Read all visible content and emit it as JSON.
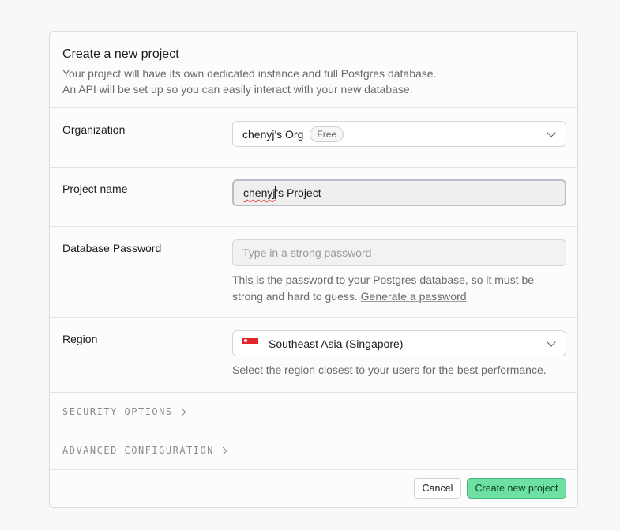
{
  "header": {
    "title": "Create a new project",
    "description_line1": "Your project will have its own dedicated instance and full Postgres database.",
    "description_line2": "An API will be set up so you can easily interact with your new database."
  },
  "organization": {
    "label": "Organization",
    "value": "chenyj's Org",
    "badge": "Free"
  },
  "project_name": {
    "label": "Project name",
    "value_misspelled": "chenyj",
    "value_rest": "'s Project"
  },
  "database_password": {
    "label": "Database Password",
    "placeholder": "Type in a strong password",
    "help_line1": "This is the password to your Postgres database, so it must be",
    "help_line2_prefix": "strong and hard to guess.",
    "generate_link": "Generate a password"
  },
  "region": {
    "label": "Region",
    "value": "Southeast Asia (Singapore)",
    "flag_icon": "singapore-flag-icon",
    "help": "Select the region closest to your users for the best performance."
  },
  "sections": {
    "security": "SECURITY OPTIONS",
    "advanced": "ADVANCED CONFIGURATION"
  },
  "footer": {
    "cancel_label": "Cancel",
    "create_label": "Create new project"
  },
  "colors": {
    "primary_button": "#6ee0a4",
    "primary_border": "#3fb37a",
    "flag_red": "#e3262b"
  }
}
